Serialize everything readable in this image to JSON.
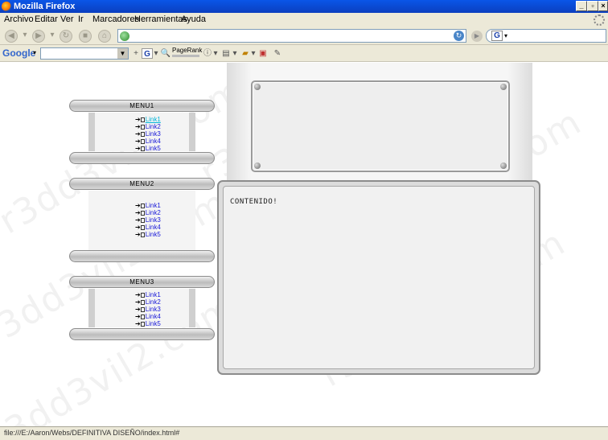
{
  "window": {
    "title": "Mozilla Firefox"
  },
  "menubar": {
    "items": [
      {
        "label": "Archivo"
      },
      {
        "label": "Editar"
      },
      {
        "label": "Ver"
      },
      {
        "label": "Ir"
      },
      {
        "label": "Marcadores"
      },
      {
        "label": "Herramientas"
      },
      {
        "label": "Ayuda"
      }
    ]
  },
  "navigation": {
    "url_value": "",
    "search_value": ""
  },
  "google_toolbar": {
    "logo": "Google",
    "pagerank_label": "PageRank"
  },
  "page": {
    "watermark": "r3dd3vil2.com",
    "content_text": "CONTENIDO!",
    "menus": [
      {
        "title": "MENU1",
        "links": [
          "Link1",
          "Link2",
          "Link3",
          "Link4",
          "Link5"
        ]
      },
      {
        "title": "MENU2",
        "links": [
          "Link1",
          "Link2",
          "Link3",
          "Link4",
          "Link5"
        ]
      },
      {
        "title": "MENU3",
        "links": [
          "Link1",
          "Link2",
          "Link3",
          "Link4",
          "Link5"
        ]
      }
    ]
  },
  "statusbar": {
    "text": "file:///E:/Aaron/Webs/DEFINITIVA DISEÑO/index.html#"
  },
  "colors": {
    "titlebar": "#0a56e8",
    "chrome": "#ece9d8",
    "link": "#1a1ad8",
    "link_hover": "#00b4d8"
  }
}
